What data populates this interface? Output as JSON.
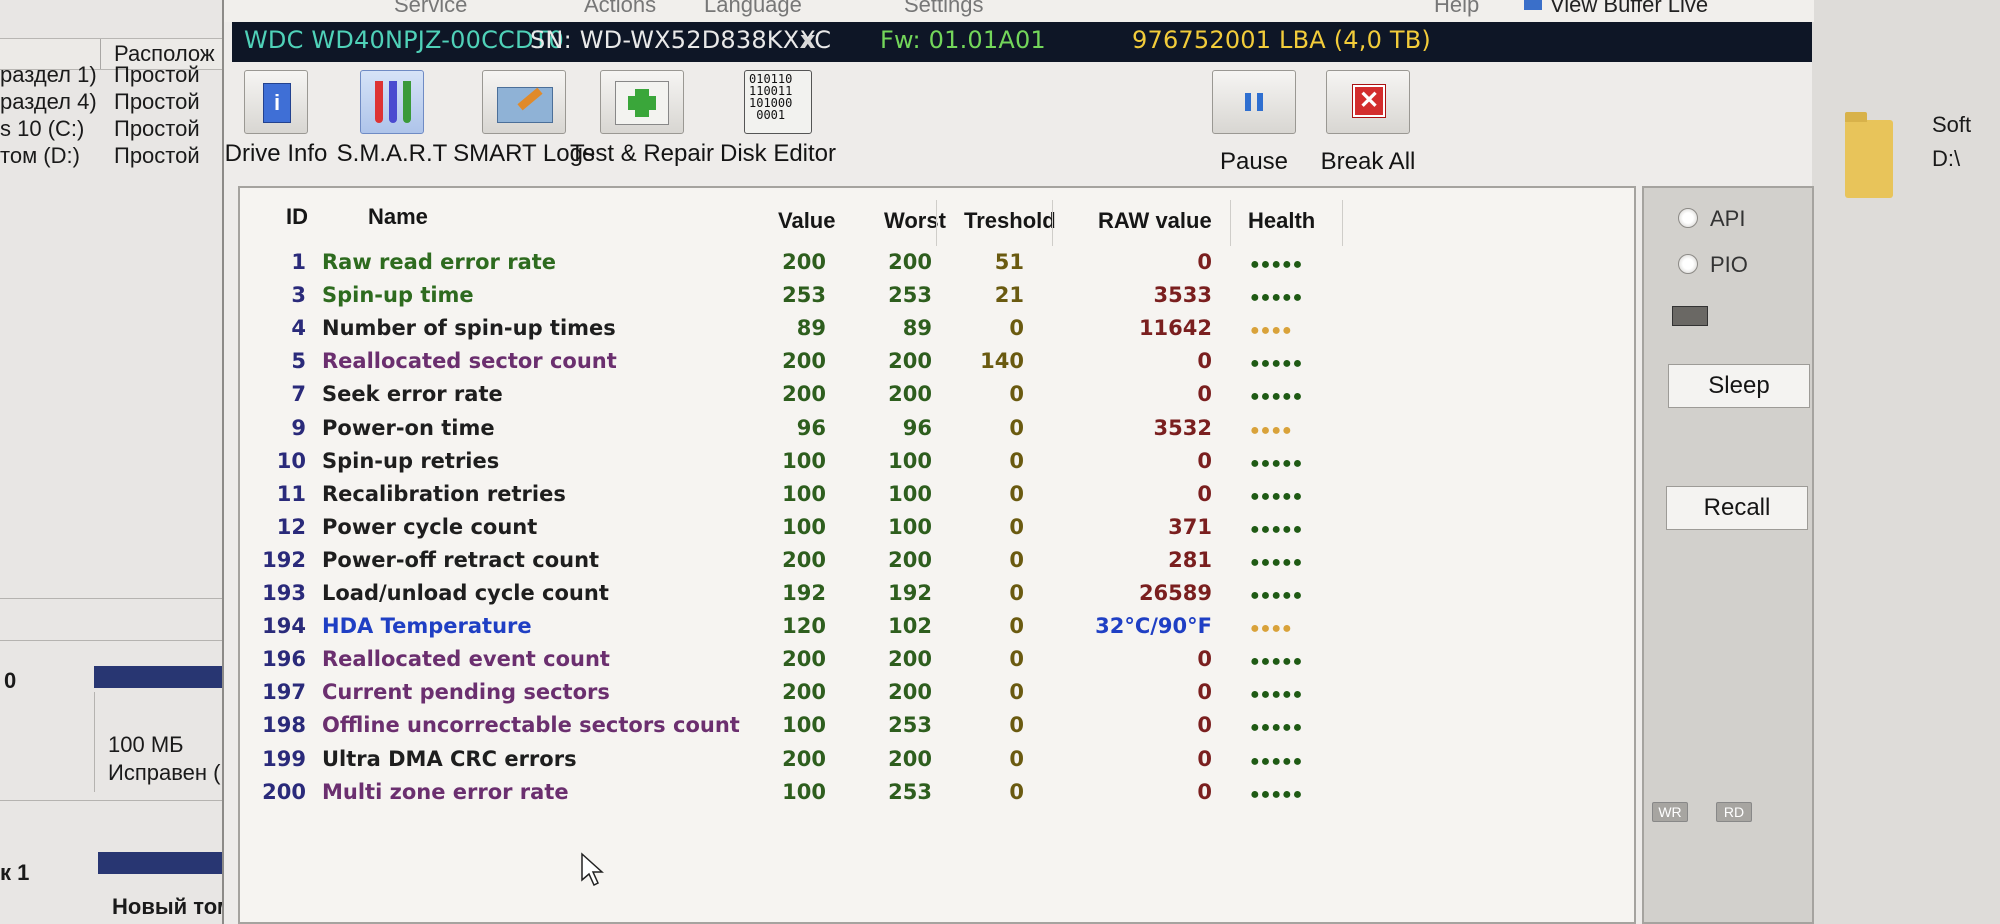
{
  "background_left": {
    "column_header": "Располож",
    "rows": [
      {
        "name": "раздел 1)",
        "layout": "Простой"
      },
      {
        "name": "раздел 4)",
        "layout": "Простой"
      },
      {
        "name": "s 10 (C:)",
        "layout": "Простой"
      },
      {
        "name": "том (D:)",
        "layout": "Простой"
      }
    ],
    "disk0_label": "0",
    "partition_size": "100 МБ",
    "partition_status": "Исправен (",
    "disk1_label": "к 1",
    "new_volume_label": "Новый том"
  },
  "background_right": {
    "folder_name": "Soft",
    "folder_path": "D:\\"
  },
  "menu": {
    "items": [
      "Service",
      "Actions",
      "Language",
      "Settings",
      "Help"
    ],
    "view_buffer": "View Buffer Live"
  },
  "drive": {
    "model": "WDC WD40NPJZ-00CCDT0",
    "serial": "SN: WD-WX52D838KXXC",
    "close": "x",
    "firmware": "Fw: 01.01A01",
    "capacity": "976752001 LBA (4,0 TB)"
  },
  "toolbar": {
    "drive_info": "Drive Info",
    "smart": "S.M.A.R.T",
    "smart_logs": "SMART Logs",
    "test_repair": "Test & Repair",
    "disk_editor": "Disk Editor",
    "disk_editor_bits": "010110\n110011\n101000\n0001",
    "pause": "Pause",
    "break_all": "Break All"
  },
  "table": {
    "headers": {
      "id": "ID",
      "name": "Name",
      "value": "Value",
      "worst": "Worst",
      "threshold": "Treshold",
      "raw": "RAW value",
      "health": "Health"
    },
    "rows": [
      {
        "id": "1",
        "name": "Raw read error rate",
        "value": "200",
        "worst": "200",
        "threshold": "51",
        "raw": "0",
        "health": 5,
        "color": "#2e6b1f"
      },
      {
        "id": "3",
        "name": "Spin-up time",
        "value": "253",
        "worst": "253",
        "threshold": "21",
        "raw": "3533",
        "health": 5,
        "color": "#2e6b1f"
      },
      {
        "id": "4",
        "name": "Number of spin-up times",
        "value": "89",
        "worst": "89",
        "threshold": "0",
        "raw": "11642",
        "health": 4,
        "color": "#1e1e1e"
      },
      {
        "id": "5",
        "name": "Reallocated sector count",
        "value": "200",
        "worst": "200",
        "threshold": "140",
        "raw": "0",
        "health": 5,
        "color": "#6b2f6f"
      },
      {
        "id": "7",
        "name": "Seek error rate",
        "value": "200",
        "worst": "200",
        "threshold": "0",
        "raw": "0",
        "health": 5,
        "color": "#1e1e1e"
      },
      {
        "id": "9",
        "name": "Power-on time",
        "value": "96",
        "worst": "96",
        "threshold": "0",
        "raw": "3532",
        "health": 4,
        "color": "#1e1e1e"
      },
      {
        "id": "10",
        "name": "Spin-up retries",
        "value": "100",
        "worst": "100",
        "threshold": "0",
        "raw": "0",
        "health": 5,
        "color": "#1e1e1e"
      },
      {
        "id": "11",
        "name": "Recalibration retries",
        "value": "100",
        "worst": "100",
        "threshold": "0",
        "raw": "0",
        "health": 5,
        "color": "#1e1e1e"
      },
      {
        "id": "12",
        "name": "Power cycle count",
        "value": "100",
        "worst": "100",
        "threshold": "0",
        "raw": "371",
        "health": 5,
        "color": "#1e1e1e"
      },
      {
        "id": "192",
        "name": "Power-off retract count",
        "value": "200",
        "worst": "200",
        "threshold": "0",
        "raw": "281",
        "health": 5,
        "color": "#1e1e1e"
      },
      {
        "id": "193",
        "name": "Load/unload cycle count",
        "value": "192",
        "worst": "192",
        "threshold": "0",
        "raw": "26589",
        "health": 5,
        "color": "#1e1e1e"
      },
      {
        "id": "194",
        "name": "HDA Temperature",
        "value": "120",
        "worst": "102",
        "threshold": "0",
        "raw": "32°C/90°F",
        "health": 4,
        "color": "#1f3fc4"
      },
      {
        "id": "196",
        "name": "Reallocated event count",
        "value": "200",
        "worst": "200",
        "threshold": "0",
        "raw": "0",
        "health": 5,
        "color": "#6b2f6f"
      },
      {
        "id": "197",
        "name": "Current pending sectors",
        "value": "200",
        "worst": "200",
        "threshold": "0",
        "raw": "0",
        "health": 5,
        "color": "#6b2f6f"
      },
      {
        "id": "198",
        "name": "Offline uncorrectable sectors count",
        "value": "100",
        "worst": "253",
        "threshold": "0",
        "raw": "0",
        "health": 5,
        "color": "#6b2f6f"
      },
      {
        "id": "199",
        "name": "Ultra DMA CRC errors",
        "value": "200",
        "worst": "200",
        "threshold": "0",
        "raw": "0",
        "health": 5,
        "color": "#1e1e1e"
      },
      {
        "id": "200",
        "name": "Multi zone error rate",
        "value": "100",
        "worst": "253",
        "threshold": "0",
        "raw": "0",
        "health": 5,
        "color": "#6b2f6f"
      }
    ]
  },
  "side": {
    "api": "API",
    "pio": "PIO",
    "sleep": "Sleep",
    "recall": "Recall",
    "wr": "WR",
    "rd": "RD"
  },
  "colors": {
    "id_color": "#2a2a7a",
    "raw_color": "#7a1f1f",
    "value_color": "#2e5e1e",
    "threshold_color": "#6a5a10",
    "health_good": "#1f5a14",
    "health_warn": "#d9a23a"
  }
}
